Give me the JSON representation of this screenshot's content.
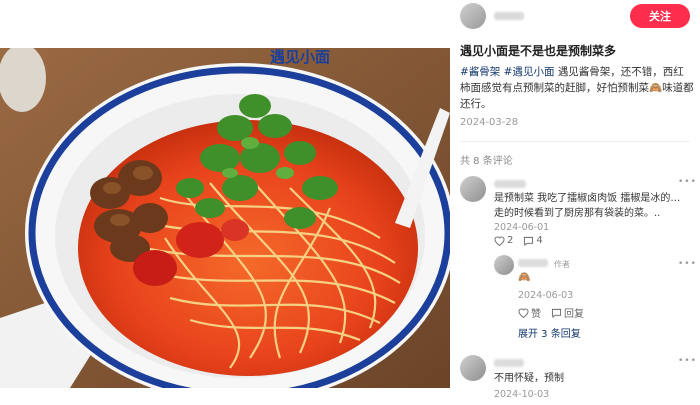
{
  "author": {
    "follow_label": "关注"
  },
  "post": {
    "title": "遇见小面是不是也是预制菜多",
    "tags": [
      "#酱骨架",
      "#遇见小面"
    ],
    "body": "遇见酱骨架，还不错，西红柿面感觉有点预制菜的赶脚，好怕预制菜🙈味道都还行。",
    "date": "2024-03-28"
  },
  "photo": {
    "bowl_brand": "遇见小面"
  },
  "comments_header": "共 8 条评论",
  "comments": [
    {
      "text": "是预制菜 我吃了擂椒卤肉饭 擂椒是冰的… 走的时候看到了厨房那有袋装的菜。..",
      "date": "2024-06-01",
      "likes": "2",
      "replies": "4"
    },
    {
      "is_author_reply": true,
      "author_badge": "作者",
      "emoji": "🙈",
      "date": "2024-06-03",
      "like_label": "赞",
      "reply_label": "回复"
    },
    {
      "expand_label": "展开 3 条回复"
    },
    {
      "text": "不用怀疑，预制",
      "date": "2024-10-03"
    }
  ],
  "colors": {
    "follow_bg": "#ff2e4d",
    "tag": "#13386c"
  },
  "icons": {
    "heart": "heart-icon",
    "comment": "comment-icon",
    "more": "more-icon"
  }
}
